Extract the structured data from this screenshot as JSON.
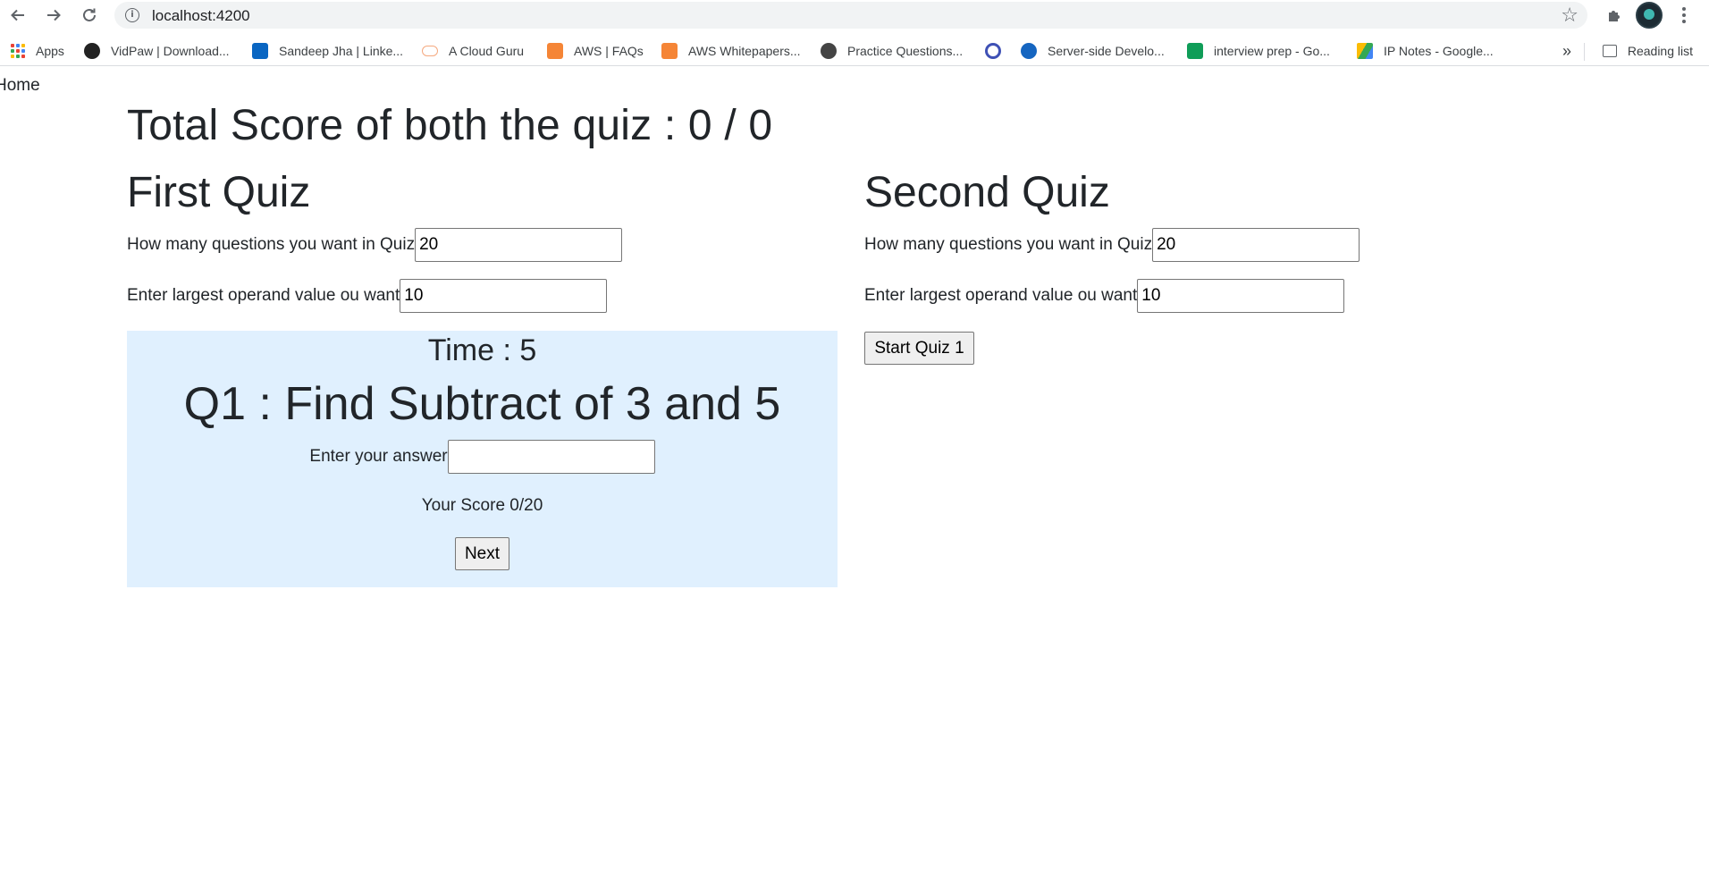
{
  "browser": {
    "url": "localhost:4200",
    "bookmarks": [
      {
        "label": "Apps",
        "icon": "apps-grid-icon"
      },
      {
        "label": "VidPaw | Download...",
        "icon": "vidpaw-icon"
      },
      {
        "label": "Sandeep Jha | Linke...",
        "icon": "linkedin-icon"
      },
      {
        "label": "A Cloud Guru",
        "icon": "cloud-icon"
      },
      {
        "label": "AWS | FAQs",
        "icon": "aws-icon"
      },
      {
        "label": "AWS Whitepapers...",
        "icon": "aws-icon"
      },
      {
        "label": "Practice Questions...",
        "icon": "practice-icon"
      },
      {
        "label": "",
        "icon": "q-icon"
      },
      {
        "label": "Server-side Develo...",
        "icon": "c-icon"
      },
      {
        "label": "interview prep - Go...",
        "icon": "sheets-icon"
      },
      {
        "label": "IP Notes - Google...",
        "icon": "drive-icon"
      }
    ],
    "overflow": "»",
    "reading_list": "Reading list",
    "colors": {
      "linkedin": "#0a66c2",
      "aws": "#f58536",
      "cloud": "#f5a97f",
      "sheets": "#0f9d58",
      "drive_yellow": "#fbbc04",
      "c_icon": "#1565c0",
      "q_icon": "#3f51b5"
    }
  },
  "page": {
    "home_link": "Home",
    "total_score": "Total Score of both the quiz : 0 / 0",
    "first_quiz": {
      "title": "First Quiz",
      "questions_label": "How many questions you want in Quiz",
      "questions_value": "20",
      "operand_label": "Enter largest operand value ou want",
      "operand_value": "10",
      "timer": "Time : 5",
      "question": "Q1 : Find Subtract of 3 and 5",
      "answer_label": "Enter your answer",
      "answer_value": "",
      "score": "Your Score 0/20",
      "next_button": "Next",
      "box_color": "#e0f0fe"
    },
    "second_quiz": {
      "title": "Second Quiz",
      "questions_label": "How many questions you want in Quiz",
      "questions_value": "20",
      "operand_label": "Enter largest operand value ou want",
      "operand_value": "10",
      "start_button": "Start Quiz 1"
    }
  }
}
